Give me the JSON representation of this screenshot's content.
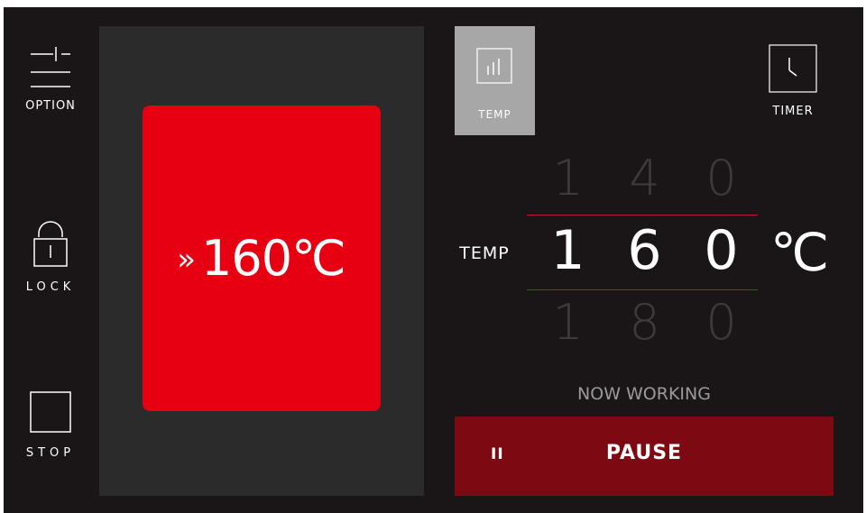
{
  "sidebar": {
    "option": {
      "label": "OPTION",
      "icon": "option-sliders-icon"
    },
    "lock": {
      "label": "LOCK",
      "icon": "lock-icon"
    },
    "stop": {
      "label": "STOP",
      "icon": "stop-square-icon"
    }
  },
  "status_card": {
    "chevron": "»",
    "value": "160",
    "unit": "℃",
    "color": "#e60012"
  },
  "tabs": {
    "temp": {
      "label": "TEMP",
      "icon": "bar-chart-icon",
      "selected": true
    },
    "timer": {
      "label": "TIMER",
      "icon": "clock-icon"
    }
  },
  "temperature_picker": {
    "label": "TEMP",
    "above": [
      "1",
      "4",
      "0"
    ],
    "current": [
      "1",
      "6",
      "0"
    ],
    "below": [
      "1",
      "8",
      "0"
    ],
    "unit": "℃"
  },
  "status_text": "NOW WORKING",
  "pause_button": {
    "icon_glyph": "II",
    "label": "PAUSE",
    "color": "#7d0a12"
  },
  "colors": {
    "background": "#1a1617",
    "panel": "#2b2b2b",
    "selected_tab": "#a7a7a7",
    "divider": "#b2192b"
  }
}
